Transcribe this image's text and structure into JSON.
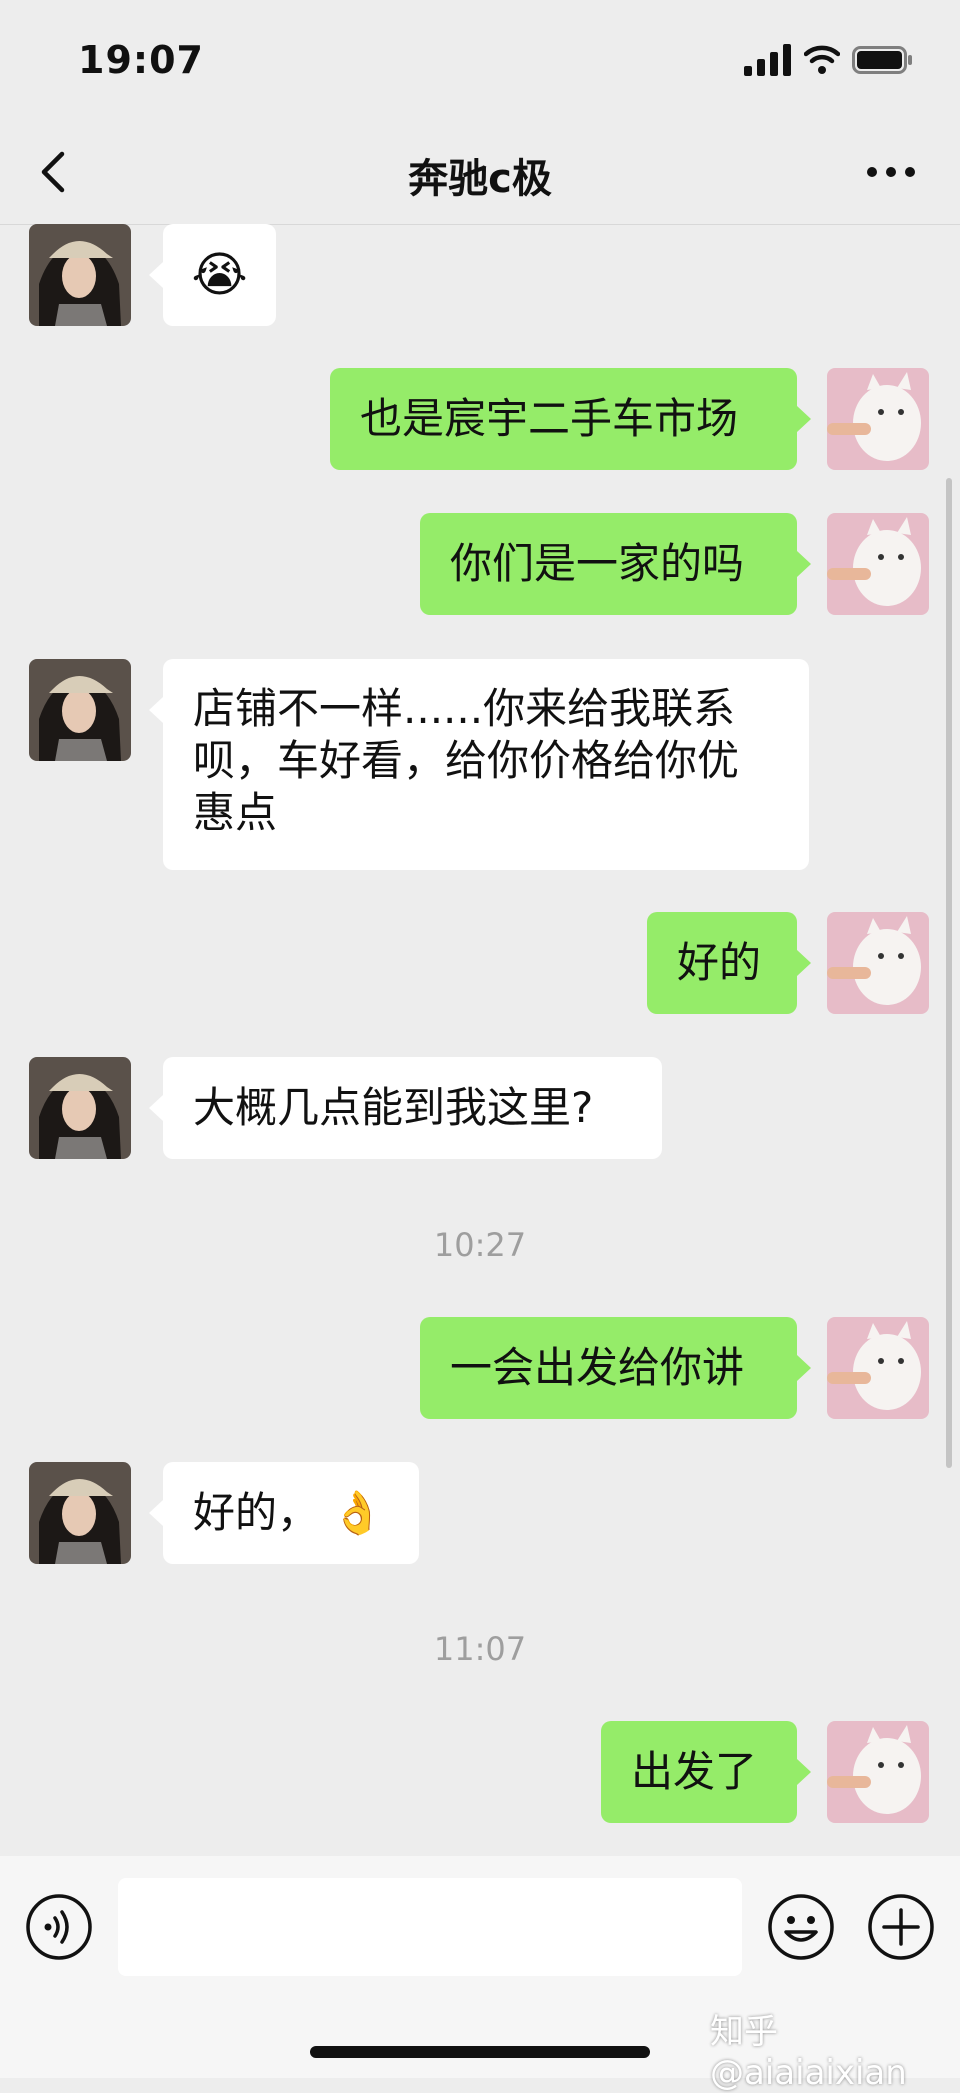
{
  "status_bar": {
    "time": "19:07"
  },
  "header": {
    "title": "奔驰c极"
  },
  "messages": [
    {
      "side": "in",
      "type": "emoji",
      "text": "😭"
    },
    {
      "side": "out",
      "type": "text",
      "text": "也是宸宇二手车市场"
    },
    {
      "side": "out",
      "type": "text",
      "text": "你们是一家的吗"
    },
    {
      "side": "in",
      "type": "text",
      "lines": [
        "店铺不一样......你来给我联系",
        "呗，车好看，给你价格给你优",
        "惠点"
      ]
    },
    {
      "side": "out",
      "type": "text",
      "text": "好的"
    },
    {
      "side": "in",
      "type": "text",
      "text": "大概几点能到我这里?"
    },
    {
      "type": "timestamp",
      "text": "10:27"
    },
    {
      "side": "out",
      "type": "text",
      "text": "一会出发给你讲"
    },
    {
      "side": "in",
      "type": "text",
      "text": "好的，",
      "emoji": "👌"
    },
    {
      "type": "timestamp",
      "text": "11:07"
    },
    {
      "side": "out",
      "type": "text",
      "text": "出发了"
    }
  ],
  "watermark": "知乎 @aiaiaixian",
  "icons": {
    "back": "back-chevron-icon",
    "more": "more-dots-icon",
    "voice": "voice-icon",
    "emoji": "emoji-icon",
    "plus": "plus-icon"
  },
  "colors": {
    "outgoing_bubble": "#95ec69",
    "incoming_bubble": "#ffffff",
    "background": "#ededed"
  }
}
